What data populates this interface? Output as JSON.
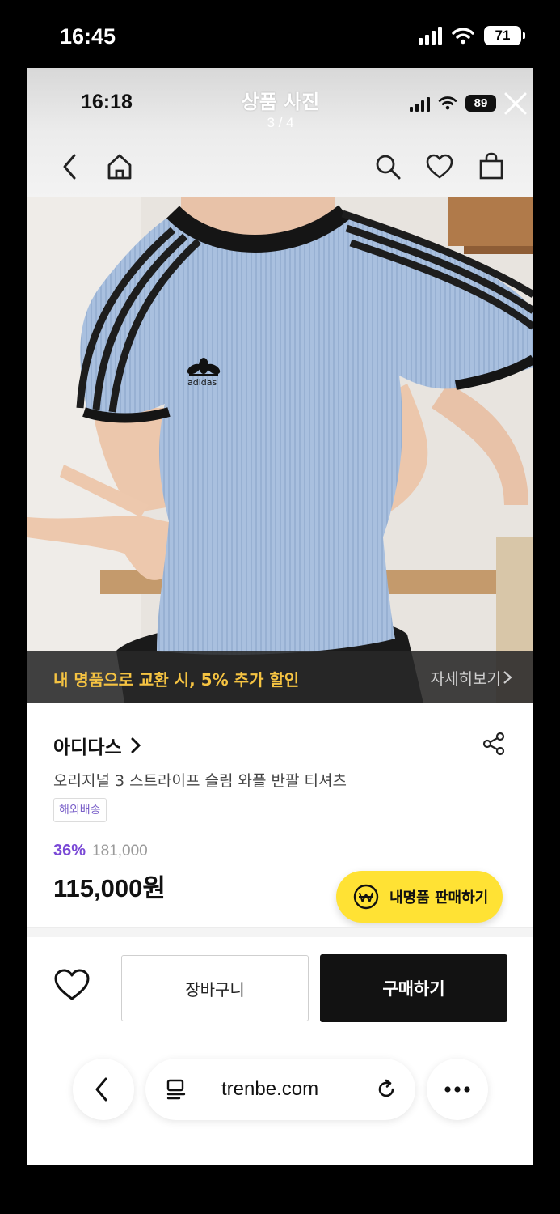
{
  "device": {
    "time": "16:45",
    "battery": "71"
  },
  "viewer": {
    "inner_time": "16:18",
    "title": "상품 사진",
    "counter": "3 / 4",
    "inner_battery": "89"
  },
  "photo": {
    "logo_text": "adidas"
  },
  "promo": {
    "text": "내 명품으로 교환 시, 5% 추가 할인",
    "more": "자세히보기"
  },
  "product": {
    "brand": "아디다스",
    "name": "오리지널 3 스트라이프 슬림 와플 반팔 티셔츠",
    "tag": "해외배송",
    "discount": "36%",
    "original_price": "181,000",
    "price": "115,000원"
  },
  "sell_button": {
    "label": "내명품 판매하기"
  },
  "buy_bar": {
    "cart_label": "장바구니",
    "buy_label": "구매하기"
  },
  "browser": {
    "url": "trenbe.com"
  },
  "colors": {
    "accent_yellow": "#ffe234",
    "discount_purple": "#7a49d6",
    "promo_text": "#f5c342",
    "buy_button": "#121212"
  }
}
